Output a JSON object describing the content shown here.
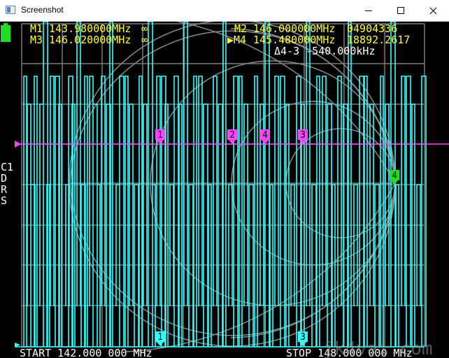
{
  "window": {
    "title": "Screenshot"
  },
  "markers": {
    "m1": {
      "label": "M1",
      "freq": "143.980000MHz",
      "value": "∞"
    },
    "m2": {
      "label": "M2",
      "freq": "146.000000MHz",
      "value": "04904336"
    },
    "m3": {
      "label": "M3",
      "freq": "146.020000MHz",
      "value": "∞"
    },
    "m4": {
      "label": "▶M4",
      "freq": "145.480000MHz",
      "value": "18892.2617"
    },
    "delta": "Δ4-3 -540.000kHz"
  },
  "side_labels": [
    "C1",
    "D",
    "R",
    "S"
  ],
  "sweep": {
    "start": "START 142.000 000 MHz",
    "stop": "STOP 148.000 000 MHz"
  },
  "watermark": "jk4vai.com",
  "trace_markers": {
    "magenta": [
      "1",
      "2",
      "4",
      "3"
    ],
    "green": "4",
    "cyan": [
      "1",
      "3"
    ]
  },
  "colors": {
    "yellow": "#ffff33",
    "cyan": "#33ffff",
    "magenta": "#ff44ff",
    "green": "#22dd22",
    "white": "#ffffff",
    "grid": "#7a7a7a"
  },
  "icons": {
    "app": "app-icon",
    "minimize": "minimize-icon",
    "maximize": "maximize-icon",
    "close": "close-icon",
    "battery": "battery-icon"
  }
}
